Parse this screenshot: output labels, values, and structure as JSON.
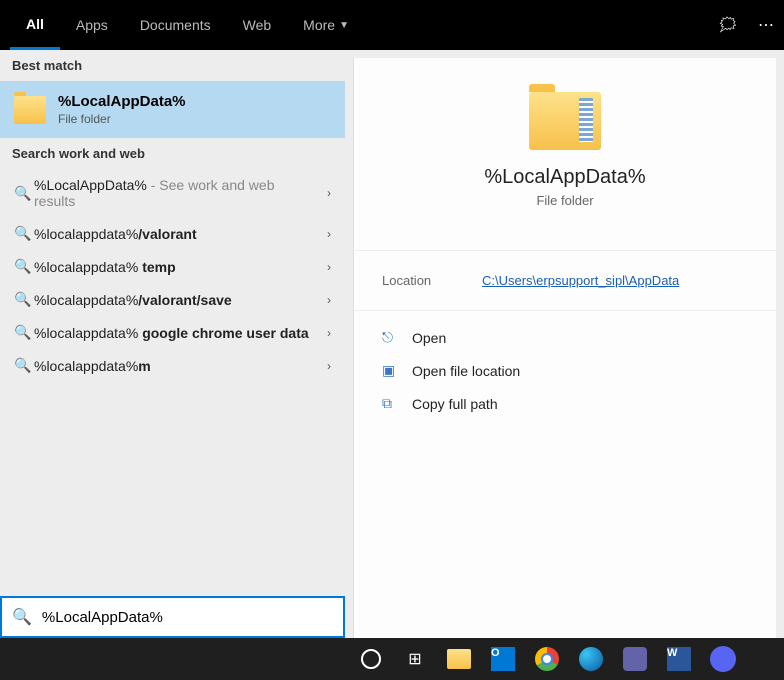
{
  "tabs": {
    "all": "All",
    "apps": "Apps",
    "documents": "Documents",
    "web": "Web",
    "more": "More"
  },
  "sections": {
    "best": "Best match",
    "web": "Search work and web"
  },
  "bestMatch": {
    "title": "%LocalAppData%",
    "subtitle": "File folder"
  },
  "webResults": [
    {
      "prefix": "%LocalAppData% ",
      "suffix": "- See work and web results",
      "bold": false
    },
    {
      "prefix": "%localappdata%",
      "suffix": "/valorant",
      "bold": true
    },
    {
      "prefix": "%localappdata% ",
      "suffix": "temp",
      "bold": true
    },
    {
      "prefix": "%localappdata%",
      "suffix": "/valorant/save",
      "bold": true
    },
    {
      "prefix": "%localappdata% ",
      "suffix": "google chrome user data",
      "bold": true
    },
    {
      "prefix": "%localappdata%",
      "suffix": "m",
      "bold": true
    }
  ],
  "preview": {
    "title": "%LocalAppData%",
    "subtitle": "File folder",
    "location_label": "Location",
    "location_value": "C:\\Users\\erpsupport_sipl\\AppData"
  },
  "actions": {
    "open": "Open",
    "openLoc": "Open file location",
    "copy": "Copy full path"
  },
  "search": {
    "value": "%LocalAppData%"
  }
}
